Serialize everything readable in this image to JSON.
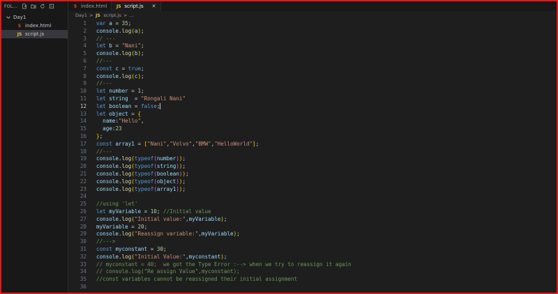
{
  "explorer": {
    "title": "FOL...",
    "folder": "Day1",
    "files": [
      {
        "name": "index.html",
        "type": "html"
      },
      {
        "name": "script.js",
        "type": "js",
        "selected": true
      }
    ]
  },
  "tabs": [
    {
      "label": "index.html",
      "type": "html",
      "active": false
    },
    {
      "label": "script.js",
      "type": "js",
      "active": true,
      "close": "✕"
    }
  ],
  "breadcrumb": {
    "folder": "Day1",
    "file": "script.js",
    "sep": ">",
    "tail": "..."
  },
  "icon_labels": {
    "html": "5",
    "js": "JS"
  },
  "editor": {
    "current_line": 12,
    "lines": [
      {
        "n": "1",
        "t": [
          [
            "kw",
            "var"
          ],
          [
            "p",
            " "
          ],
          [
            "var",
            "a"
          ],
          [
            "p",
            " = "
          ],
          [
            "num",
            "35"
          ],
          [
            "p",
            ";"
          ]
        ]
      },
      {
        "n": "2",
        "t": [
          [
            "var",
            "console"
          ],
          [
            "p",
            "."
          ],
          [
            "fn",
            "log"
          ],
          [
            "b1",
            "("
          ],
          [
            "var",
            "a"
          ],
          [
            "b1",
            ")"
          ],
          [
            "p",
            ";"
          ]
        ]
      },
      {
        "n": "3",
        "t": [
          [
            "com",
            "// ---"
          ]
        ]
      },
      {
        "n": "4",
        "t": [
          [
            "kw",
            "let"
          ],
          [
            "p",
            " "
          ],
          [
            "var",
            "b"
          ],
          [
            "p",
            " = "
          ],
          [
            "str",
            "\"Nani\""
          ],
          [
            "p",
            ";"
          ]
        ]
      },
      {
        "n": "5",
        "t": [
          [
            "var",
            "console"
          ],
          [
            "p",
            "."
          ],
          [
            "fn",
            "log"
          ],
          [
            "b1",
            "("
          ],
          [
            "var",
            "b"
          ],
          [
            "b1",
            ")"
          ],
          [
            "p",
            ";"
          ]
        ]
      },
      {
        "n": "6",
        "t": [
          [
            "com",
            "//---"
          ]
        ]
      },
      {
        "n": "7",
        "t": [
          [
            "kw",
            "const"
          ],
          [
            "p",
            " "
          ],
          [
            "var",
            "c"
          ],
          [
            "p",
            " = "
          ],
          [
            "kw",
            "true"
          ],
          [
            "p",
            ";"
          ]
        ]
      },
      {
        "n": "8",
        "t": [
          [
            "var",
            "console"
          ],
          [
            "p",
            "."
          ],
          [
            "fn",
            "log"
          ],
          [
            "b1",
            "("
          ],
          [
            "var",
            "c"
          ],
          [
            "b1",
            ")"
          ],
          [
            "p",
            ";"
          ]
        ]
      },
      {
        "n": "9",
        "t": [
          [
            "com",
            "//---"
          ]
        ]
      },
      {
        "n": "10",
        "t": [
          [
            "kw",
            "let"
          ],
          [
            "p",
            " "
          ],
          [
            "var",
            "number"
          ],
          [
            "p",
            " = "
          ],
          [
            "num",
            "1"
          ],
          [
            "p",
            ";"
          ]
        ]
      },
      {
        "n": "11",
        "t": [
          [
            "kw",
            "let"
          ],
          [
            "p",
            " "
          ],
          [
            "var",
            "string"
          ],
          [
            "p",
            "  = "
          ],
          [
            "str",
            "\"Rongali Nani\""
          ]
        ]
      },
      {
        "n": "12",
        "t": [
          [
            "kw",
            "let"
          ],
          [
            "p",
            " "
          ],
          [
            "var",
            "boolean"
          ],
          [
            "p",
            " = "
          ],
          [
            "kw",
            "false"
          ],
          [
            "p",
            ";"
          ],
          [
            "cursor",
            ""
          ]
        ]
      },
      {
        "n": "13",
        "t": [
          [
            "kw",
            "let"
          ],
          [
            "p",
            " "
          ],
          [
            "var",
            "object"
          ],
          [
            "p",
            " = "
          ],
          [
            "b1",
            "{"
          ]
        ]
      },
      {
        "n": "14",
        "t": [
          [
            "p",
            "  "
          ],
          [
            "prop",
            "name"
          ],
          [
            "p",
            ":"
          ],
          [
            "str",
            "\"Hello\""
          ],
          [
            "p",
            ","
          ]
        ]
      },
      {
        "n": "15",
        "t": [
          [
            "p",
            "  "
          ],
          [
            "prop",
            "age"
          ],
          [
            "p",
            ":"
          ],
          [
            "num",
            "23"
          ]
        ]
      },
      {
        "n": "16",
        "t": [
          [
            "b1",
            "}"
          ],
          [
            "p",
            ";"
          ]
        ]
      },
      {
        "n": "17",
        "t": [
          [
            "kw",
            "const"
          ],
          [
            "p",
            " "
          ],
          [
            "var",
            "array1"
          ],
          [
            "p",
            " = "
          ],
          [
            "b1",
            "["
          ],
          [
            "str",
            "\"Nani\""
          ],
          [
            "p",
            ","
          ],
          [
            "str",
            "\"Volvo\""
          ],
          [
            "p",
            ","
          ],
          [
            "str",
            "\"BMW\""
          ],
          [
            "p",
            ","
          ],
          [
            "str",
            "\"HelloWorld\""
          ],
          [
            "b1",
            "]"
          ],
          [
            "p",
            ";"
          ]
        ]
      },
      {
        "n": "18",
        "t": [
          [
            "com",
            "//---"
          ]
        ]
      },
      {
        "n": "19",
        "t": [
          [
            "var",
            "console"
          ],
          [
            "p",
            "."
          ],
          [
            "fn",
            "log"
          ],
          [
            "b1",
            "("
          ],
          [
            "kw",
            "typeof"
          ],
          [
            "b2",
            "("
          ],
          [
            "var",
            "number"
          ],
          [
            "b2",
            ")"
          ],
          [
            "b1",
            ")"
          ],
          [
            "p",
            ";"
          ]
        ]
      },
      {
        "n": "20",
        "t": [
          [
            "var",
            "console"
          ],
          [
            "p",
            "."
          ],
          [
            "fn",
            "log"
          ],
          [
            "b1",
            "("
          ],
          [
            "kw",
            "typeof"
          ],
          [
            "b2",
            "("
          ],
          [
            "var",
            "string"
          ],
          [
            "b2",
            ")"
          ],
          [
            "b1",
            ")"
          ],
          [
            "p",
            ";"
          ]
        ]
      },
      {
        "n": "21",
        "t": [
          [
            "var",
            "console"
          ],
          [
            "p",
            "."
          ],
          [
            "fn",
            "log"
          ],
          [
            "b1",
            "("
          ],
          [
            "kw",
            "typeof"
          ],
          [
            "b2",
            "("
          ],
          [
            "var",
            "boolean"
          ],
          [
            "b2",
            ")"
          ],
          [
            "b1",
            ")"
          ],
          [
            "p",
            ";"
          ]
        ]
      },
      {
        "n": "22",
        "t": [
          [
            "var",
            "console"
          ],
          [
            "p",
            "."
          ],
          [
            "fn",
            "log"
          ],
          [
            "b1",
            "("
          ],
          [
            "kw",
            "typeof"
          ],
          [
            "b2",
            "("
          ],
          [
            "var",
            "object"
          ],
          [
            "b2",
            ")"
          ],
          [
            "b1",
            ")"
          ],
          [
            "p",
            ";"
          ]
        ]
      },
      {
        "n": "23",
        "t": [
          [
            "var",
            "console"
          ],
          [
            "p",
            "."
          ],
          [
            "fn",
            "log"
          ],
          [
            "b1",
            "("
          ],
          [
            "kw",
            "typeof"
          ],
          [
            "b2",
            "("
          ],
          [
            "var",
            "array1"
          ],
          [
            "b2",
            ")"
          ],
          [
            "b1",
            ")"
          ],
          [
            "p",
            ";"
          ]
        ]
      },
      {
        "n": "24",
        "t": []
      },
      {
        "n": "25",
        "t": [
          [
            "com",
            "//using 'let'"
          ]
        ]
      },
      {
        "n": "26",
        "t": [
          [
            "kw",
            "let"
          ],
          [
            "p",
            " "
          ],
          [
            "var",
            "myVariable"
          ],
          [
            "p",
            " = "
          ],
          [
            "num",
            "10"
          ],
          [
            "p",
            "; "
          ],
          [
            "com",
            "//Initial value"
          ]
        ]
      },
      {
        "n": "27",
        "t": [
          [
            "var",
            "console"
          ],
          [
            "p",
            "."
          ],
          [
            "fn",
            "log"
          ],
          [
            "b1",
            "("
          ],
          [
            "str",
            "\"Initial value:\""
          ],
          [
            "p",
            ","
          ],
          [
            "var",
            "myVariable"
          ],
          [
            "b1",
            ")"
          ],
          [
            "p",
            ";"
          ]
        ]
      },
      {
        "n": "28",
        "t": [
          [
            "var",
            "myVariable"
          ],
          [
            "p",
            " = "
          ],
          [
            "num",
            "20"
          ],
          [
            "p",
            ";"
          ]
        ]
      },
      {
        "n": "29",
        "t": [
          [
            "var",
            "console"
          ],
          [
            "p",
            "."
          ],
          [
            "fn",
            "log"
          ],
          [
            "b1",
            "("
          ],
          [
            "str",
            "\"Reassign variable:\""
          ],
          [
            "p",
            ","
          ],
          [
            "var",
            "myVariable"
          ],
          [
            "b1",
            ")"
          ],
          [
            "p",
            ";"
          ]
        ]
      },
      {
        "n": "30",
        "t": [
          [
            "com",
            "//--->"
          ]
        ]
      },
      {
        "n": "31",
        "t": [
          [
            "kw",
            "const"
          ],
          [
            "p",
            " "
          ],
          [
            "var",
            "myconstant"
          ],
          [
            "p",
            " = "
          ],
          [
            "num",
            "30"
          ],
          [
            "p",
            ";"
          ]
        ]
      },
      {
        "n": "32",
        "t": [
          [
            "var",
            "console"
          ],
          [
            "p",
            "."
          ],
          [
            "fn",
            "log"
          ],
          [
            "b1",
            "("
          ],
          [
            "str",
            "\"Initial Value:\""
          ],
          [
            "p",
            ","
          ],
          [
            "var",
            "myconstant"
          ],
          [
            "b1",
            ")"
          ],
          [
            "p",
            ";"
          ]
        ]
      },
      {
        "n": "33",
        "t": [
          [
            "com",
            "// myconstant = 40;  we got the Type Error :--> when we try to reassign it again"
          ]
        ]
      },
      {
        "n": "34",
        "t": [
          [
            "com",
            "// console.log(\"Re assign Value\",myconstant);"
          ]
        ]
      },
      {
        "n": "35",
        "t": [
          [
            "com",
            "//const variables cannot be reassigned their initial assignment"
          ]
        ]
      },
      {
        "n": "36",
        "t": []
      }
    ]
  }
}
